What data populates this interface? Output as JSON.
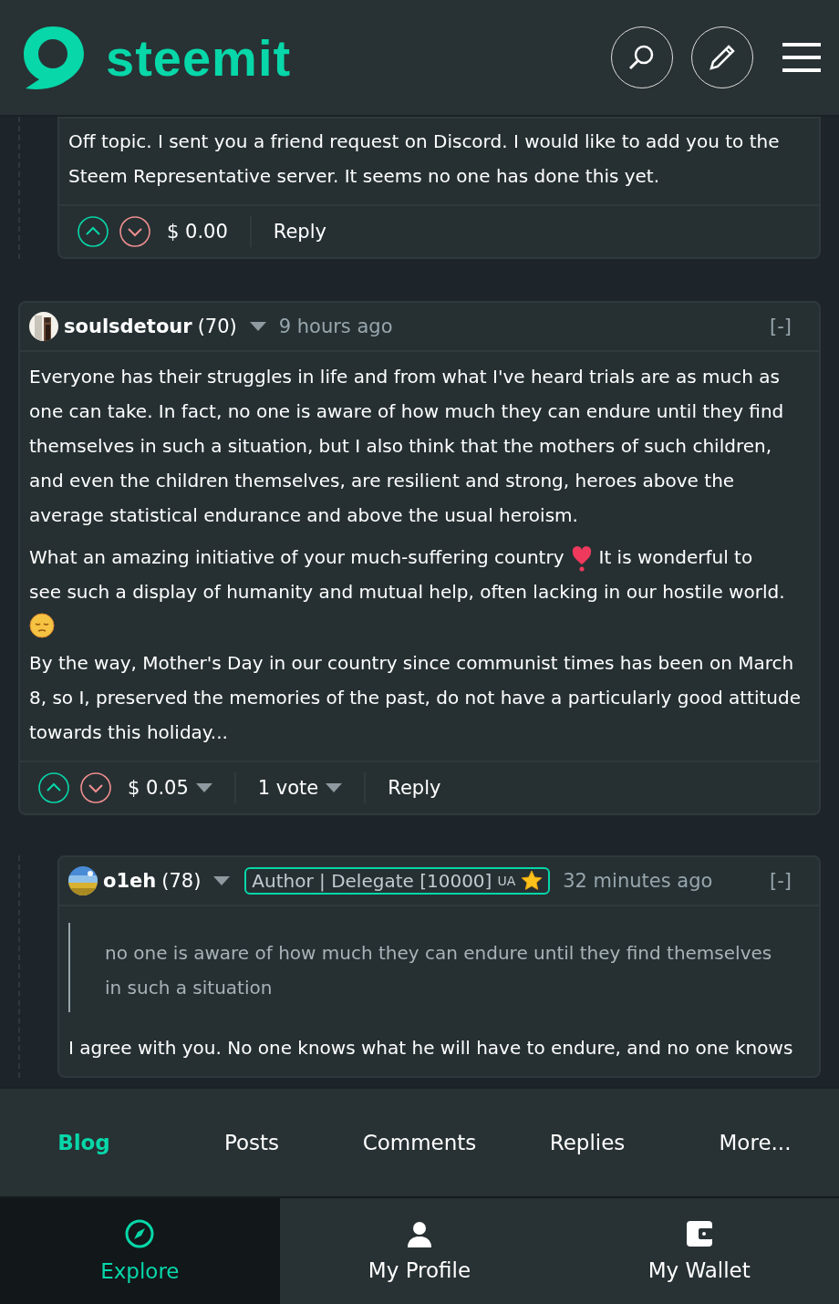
{
  "header": {
    "logo_text": "steemit"
  },
  "comments": [
    {
      "nested": true,
      "cut_top": true,
      "paragraphs": [
        [
          {
            "kind": "text",
            "text": "Off topic. I sent you a friend request on Discord. I would like to add you to the Steem Representative server. It seems no one has done this yet."
          }
        ]
      ],
      "footer": {
        "payout": "$ 0.00",
        "payout_menu": false,
        "reply": "Reply"
      }
    },
    {
      "nested": false,
      "cut_top": false,
      "author": "soulsdetour",
      "reputation": "(70)",
      "time": "9 hours ago",
      "collapse": "[-]",
      "paragraphs": [
        [
          {
            "kind": "text",
            "text": "Everyone has their struggles in life and from what I've heard trials are as much as one can take. In fact, no one is aware of how much they can endure until they find themselves in such a situation, but I also think that the mothers of such children, and even the children themselves, are resilient and strong, heroes above the average statistical endurance and above the usual heroism."
          }
        ],
        [
          {
            "kind": "text",
            "text": "What an amazing initiative of your much-suffering country"
          },
          {
            "kind": "heart"
          },
          {
            "kind": "text",
            "text": "It is wonderful to"
          },
          {
            "kind": "line",
            "text": "see such a display of humanity and mutual help, often lacking in our hostile world."
          },
          {
            "kind": "sad-face"
          }
        ],
        [
          {
            "kind": "text",
            "text": "By the way, Mother's Day in our country since communist times has been on March 8, so I, preserved the memories of the past, do not have a particularly good attitude towards this holiday..."
          }
        ]
      ],
      "footer": {
        "payout": "$ 0.05",
        "payout_menu": true,
        "votes": "1 vote",
        "reply": "Reply"
      }
    },
    {
      "nested": true,
      "cut_top": false,
      "author": "o1eh",
      "reputation": "(78)",
      "badge": {
        "text": "Author | Delegate [10000]",
        "suffix": "UA"
      },
      "time": "32 minutes ago",
      "collapse": "[-]",
      "quote": "no one is aware of how much they can endure until they find themselves in such a situation",
      "paragraphs": [
        [
          {
            "kind": "text",
            "text": "I agree with you. No one knows what he will have to endure, and no one knows"
          }
        ]
      ]
    }
  ],
  "tabs": [
    {
      "label": "Blog",
      "selected": true
    },
    {
      "label": "Posts",
      "selected": false
    },
    {
      "label": "Comments",
      "selected": false
    },
    {
      "label": "Replies",
      "selected": false
    },
    {
      "label": "More...",
      "selected": false
    }
  ],
  "nav": [
    {
      "kind": "explore",
      "label": "Explore",
      "selected": true
    },
    {
      "kind": "profile",
      "label": "My Profile",
      "selected": false
    },
    {
      "kind": "wallet",
      "label": "My Wallet",
      "selected": false
    }
  ]
}
